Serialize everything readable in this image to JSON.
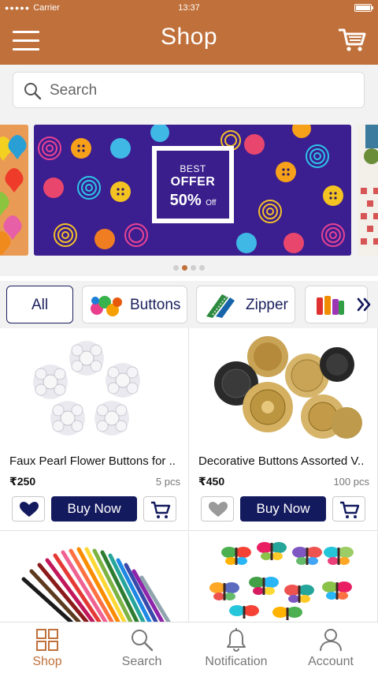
{
  "status_bar": {
    "carrier": "Carrier",
    "time": "13:37"
  },
  "header": {
    "title": "Shop"
  },
  "search": {
    "placeholder": "Search"
  },
  "banner": {
    "offer_line1": "BEST",
    "offer_line2": "OFFER",
    "offer_percent": "50%",
    "offer_suffix": "Off",
    "pages": 4,
    "active_page": 1
  },
  "categories": [
    {
      "label": "All",
      "active": true
    },
    {
      "label": "Buttons",
      "active": false
    },
    {
      "label": "Zipper",
      "active": false
    }
  ],
  "products": [
    {
      "name": "Faux Pearl Flower Buttons for ..",
      "price": "₹250",
      "quantity": "5 pcs",
      "buy_label": "Buy Now",
      "favorite": true
    },
    {
      "name": "Decorative Buttons Assorted V..",
      "price": "₹450",
      "quantity": "100 pcs",
      "buy_label": "Buy Now",
      "favorite": false
    },
    {
      "name": "",
      "price": "",
      "quantity": "",
      "buy_label": "",
      "favorite": false
    },
    {
      "name": "",
      "price": "",
      "quantity": "",
      "buy_label": "",
      "favorite": false
    }
  ],
  "bottom_nav": [
    {
      "label": "Shop",
      "icon": "grid-icon",
      "active": true
    },
    {
      "label": "Search",
      "icon": "search-icon",
      "active": false
    },
    {
      "label": "Notification",
      "icon": "bell-icon",
      "active": false
    },
    {
      "label": "Account",
      "icon": "user-icon",
      "active": false
    }
  ],
  "colors": {
    "brand": "#c0703a",
    "primary": "#141a5e",
    "background": "#f2f2f2"
  }
}
